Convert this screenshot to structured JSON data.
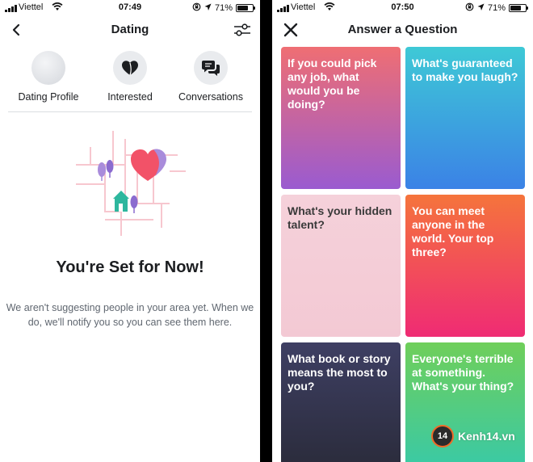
{
  "left_screen": {
    "status": {
      "carrier": "Viettel",
      "time": "07:49",
      "battery": "71%",
      "battery_level": 0.71
    },
    "nav": {
      "title": "Dating"
    },
    "tabs": [
      {
        "label": "Dating Profile",
        "icon": "avatar-icon"
      },
      {
        "label": "Interested",
        "icon": "heart-icon"
      },
      {
        "label": "Conversations",
        "icon": "chat-bubbles-icon"
      }
    ],
    "empty_state": {
      "title": "You're Set for Now!",
      "description": "We aren't suggesting people in your area yet. When we do, we'll notify you so you can see them here."
    }
  },
  "right_screen": {
    "status": {
      "carrier": "Viettel",
      "time": "07:50",
      "battery": "71%",
      "battery_level": 0.71
    },
    "nav": {
      "title": "Answer a Question"
    },
    "questions": [
      {
        "text": "If you could pick any job, what would you be doing?",
        "gradient": [
          "#ef6e73",
          "#9a5bd0"
        ]
      },
      {
        "text": "What's guaranteed to make you laugh?",
        "gradient": [
          "#3ec9d6",
          "#3b82e6"
        ]
      },
      {
        "text": "What's your hidden talent?",
        "gradient": [
          "#f5d1da",
          "#f3c9d4"
        ]
      },
      {
        "text": "You can meet anyone in the world. Your top three?",
        "gradient": [
          "#f5743c",
          "#ef2b74"
        ]
      },
      {
        "text": "What book or story means the most to you?",
        "gradient": [
          "#3e3f63",
          "#2a2b3a"
        ]
      },
      {
        "text": "Everyone's terrible at something. What's your thing?",
        "gradient": [
          "#6fcf5a",
          "#38c9a8"
        ]
      }
    ]
  },
  "watermark": {
    "badge": "14",
    "text": "Kenh14.vn"
  }
}
